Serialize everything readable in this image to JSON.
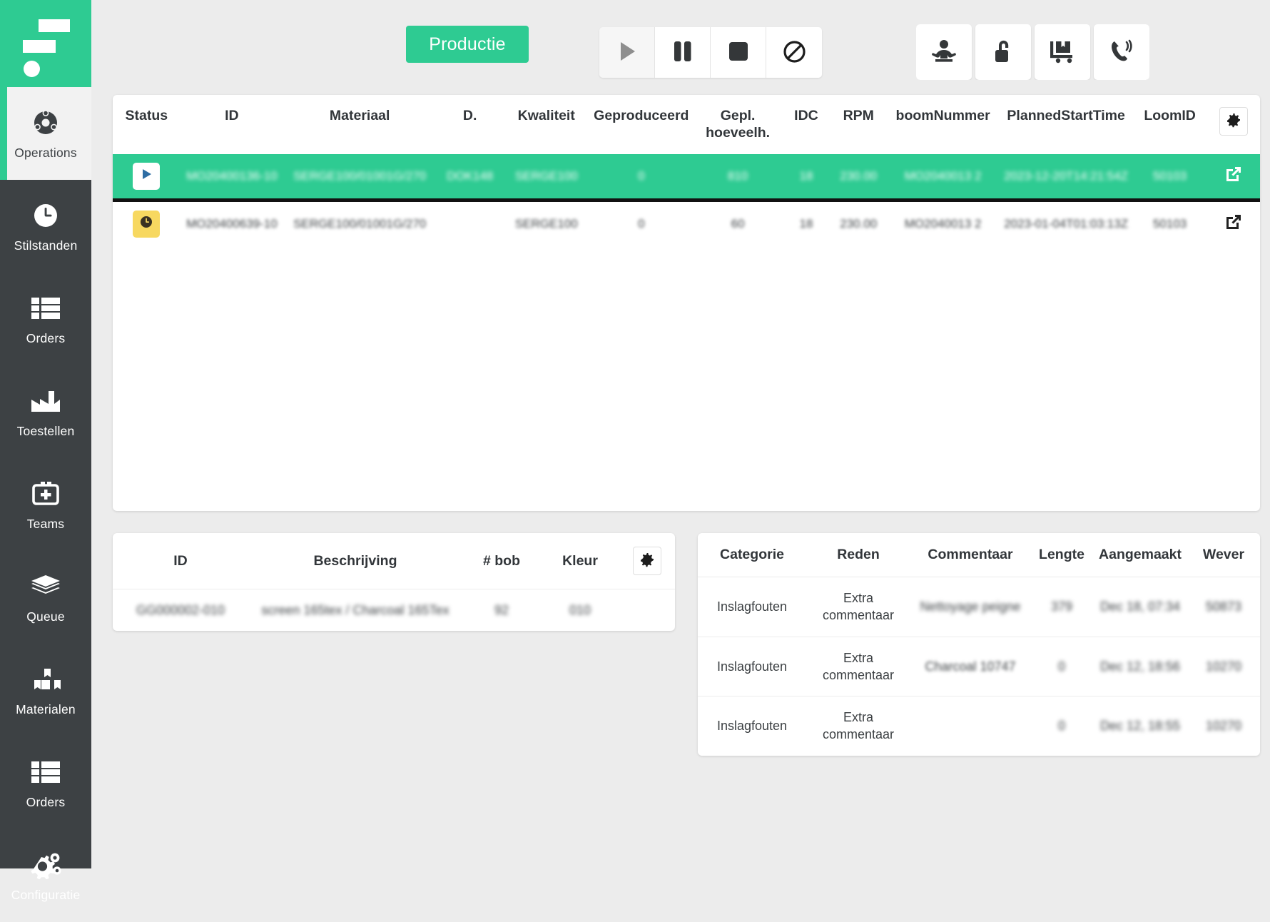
{
  "sidebar": {
    "logo_name": "app-logo",
    "items": [
      {
        "label": "Operations",
        "icon": "operations-icon",
        "active": true
      },
      {
        "label": "Stilstanden",
        "icon": "clock-icon",
        "active": false
      },
      {
        "label": "Orders",
        "icon": "list-icon",
        "active": false
      },
      {
        "label": "Toestellen",
        "icon": "factory-icon",
        "active": false
      },
      {
        "label": "Teams",
        "icon": "team-add-icon",
        "active": false
      },
      {
        "label": "Queue",
        "icon": "layers-icon",
        "active": false
      },
      {
        "label": "Materialen",
        "icon": "boxes-icon",
        "active": false
      },
      {
        "label": "Orders",
        "icon": "list-icon",
        "active": false
      },
      {
        "label": "Configuratie",
        "icon": "gears-icon",
        "active": false
      }
    ]
  },
  "topbar": {
    "productie_label": "Productie",
    "playback_buttons": [
      {
        "name": "play-button",
        "icon": "play-icon",
        "disabled": true
      },
      {
        "name": "pause-button",
        "icon": "pause-icon",
        "disabled": false
      },
      {
        "name": "stop-button",
        "icon": "stop-icon",
        "disabled": false
      },
      {
        "name": "block-button",
        "icon": "block-icon",
        "disabled": false
      }
    ],
    "action_buttons": [
      {
        "name": "weaver-button",
        "icon": "weaver-icon"
      },
      {
        "name": "unlock-button",
        "icon": "unlock-icon"
      },
      {
        "name": "delivery-button",
        "icon": "dolly-icon"
      },
      {
        "name": "call-button",
        "icon": "phone-ring-icon"
      }
    ]
  },
  "main_table": {
    "settings_icon": "gear-icon",
    "columns": [
      "Status",
      "ID",
      "Materiaal",
      "D.",
      "Kwaliteit",
      "Geproduceerd",
      "Gepl. hoeveelh.",
      "IDC",
      "RPM",
      "boomNummer",
      "PlannedStartTime",
      "LoomID",
      ""
    ],
    "rows": [
      {
        "selected": true,
        "status_icon": "play-icon",
        "status_chip": "chip-white",
        "id": "MO20400136-10",
        "materiaal": "SERGE100/01001G/270",
        "d": "DOK148",
        "kwaliteit": "SERGE100",
        "geproduceerd": "0",
        "gepl_hoeveelh": "810",
        "idc": "18",
        "rpm": "230.00",
        "boom_nummer": "MO2040013 2",
        "planned_start_time": "2023-12-20T14:21:54Z",
        "loom_id": "50103",
        "open_icon": "external-link-icon"
      },
      {
        "selected": false,
        "status_icon": "clock-icon",
        "status_chip": "chip-yellow",
        "id": "MO20400639-10",
        "materiaal": "SERGE100/01001G/270",
        "d": "",
        "kwaliteit": "SERGE100",
        "geproduceerd": "0",
        "gepl_hoeveelh": "60",
        "idc": "18",
        "rpm": "230.00",
        "boom_nummer": "MO2040013 2",
        "planned_start_time": "2023-01-04T01:03:13Z",
        "loom_id": "50103",
        "open_icon": "external-link-icon"
      }
    ]
  },
  "beams_table": {
    "settings_icon": "gear-icon",
    "columns": [
      "ID",
      "Beschrijving",
      "# bob",
      "Kleur",
      ""
    ],
    "rows": [
      {
        "id": "GG000002-010",
        "beschrijving": "screen 165tex / Charcoal 165Tex",
        "bob": "92",
        "kleur": "010"
      }
    ]
  },
  "stops_table": {
    "columns": [
      "Categorie",
      "Reden",
      "Commentaar",
      "Lengte",
      "Aangemaakt",
      "Wever"
    ],
    "rows": [
      {
        "categorie": "Inslagfouten",
        "reden": "Extra commentaar",
        "commentaar": "Nettoyage peigne",
        "lengte": "379",
        "aangemaakt": "Dec 18, 07:34",
        "wever": "50873"
      },
      {
        "categorie": "Inslagfouten",
        "reden": "Extra commentaar",
        "commentaar": "Charcoal 10747",
        "lengte": "0",
        "aangemaakt": "Dec 12, 18:56",
        "wever": "10270"
      },
      {
        "categorie": "Inslagfouten",
        "reden": "Extra commentaar",
        "commentaar": "",
        "lengte": "0",
        "aangemaakt": "Dec 12, 18:55",
        "wever": "10270"
      }
    ]
  },
  "colors": {
    "brand_green": "#2ecb92",
    "sidebar_dark": "#3d4144",
    "page_bg": "#ececec",
    "status_yellow": "#f7d860",
    "play_blue": "#2e6da4"
  }
}
